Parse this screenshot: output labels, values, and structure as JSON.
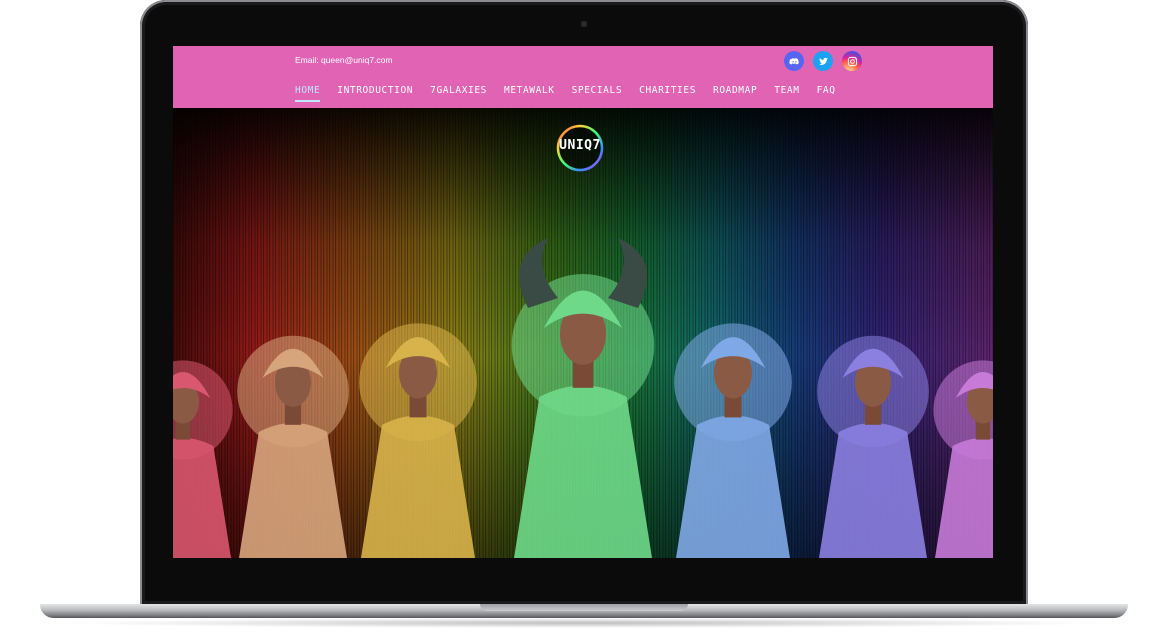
{
  "site": {
    "email_text": "Email: queen@uniq7.com",
    "logo_text": "UNIQ7",
    "socials": [
      {
        "name": "discord",
        "icon": "discord-icon"
      },
      {
        "name": "twitter",
        "icon": "twitter-icon"
      },
      {
        "name": "instagram",
        "icon": "instagram-icon"
      }
    ],
    "nav": [
      {
        "label": "HOME",
        "active": true
      },
      {
        "label": "INTRODUCTION"
      },
      {
        "label": "7GALAXIES"
      },
      {
        "label": "METAWALK"
      },
      {
        "label": "SPECIALS"
      },
      {
        "label": "CHARITIES"
      },
      {
        "label": "ROADMAP"
      },
      {
        "label": "TEAM"
      },
      {
        "label": "FAQ"
      }
    ]
  },
  "colors": {
    "topbar": "#e063b4",
    "nav_active": "#bfe6ff",
    "queens": [
      "#d9576f",
      "#d7a57c",
      "#d8b24a",
      "#6fd98a",
      "#7fa8e6",
      "#8b7fe0",
      "#c77ad8"
    ]
  }
}
